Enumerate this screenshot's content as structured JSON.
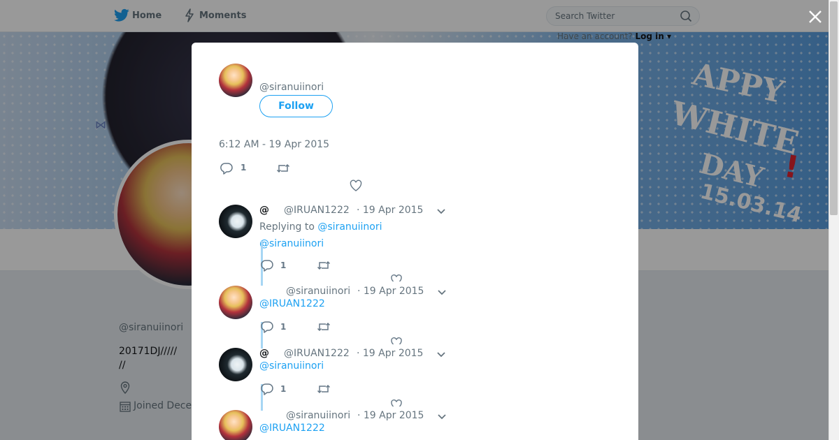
{
  "nav": {
    "home_label": "Home",
    "moments_label": "Moments",
    "search_placeholder": "Search Twitter",
    "account_prompt": "Have an account?",
    "login_label": "Log in"
  },
  "banner": {
    "line1": "APPY",
    "line2": "WHITE",
    "line3": "DAY",
    "exclaim": "!",
    "date": "15.03.14"
  },
  "profile": {
    "name": "",
    "handle": "@siranuiinori",
    "bio_line1": "20171DJ/////",
    "bio_line2": "//",
    "joined": "Joined Dece"
  },
  "modal": {
    "handle": "@siranuiinori",
    "follow_label": "Follow",
    "tweet_text": "",
    "timestamp": "6:12 AM - 19 Apr 2015",
    "reply_count": "1"
  },
  "replies": [
    {
      "at": "@",
      "handle": "@IRUAN1222",
      "date": "· 19 Apr 2015",
      "replying_prefix": "Replying to",
      "replying_to": "@siranuiinori",
      "mention": "@siranuiinori",
      "reply_count": "1"
    },
    {
      "at": "",
      "handle": "@siranuiinori",
      "date": "· 19 Apr 2015",
      "mention": "@IRUAN1222",
      "reply_count": "1"
    },
    {
      "at": "@",
      "handle": "@IRUAN1222",
      "date": "· 19 Apr 2015",
      "mention": "@siranuiinori",
      "reply_count": "1"
    },
    {
      "at": "",
      "handle": "@siranuiinori",
      "date": "· 19 Apr 2015",
      "mention": "@IRUAN1222",
      "reply_count": ""
    }
  ],
  "colors": {
    "accent": "#1da1f2",
    "text": "#14171a",
    "muted": "#66757f",
    "thread": "#a7d6f4"
  }
}
